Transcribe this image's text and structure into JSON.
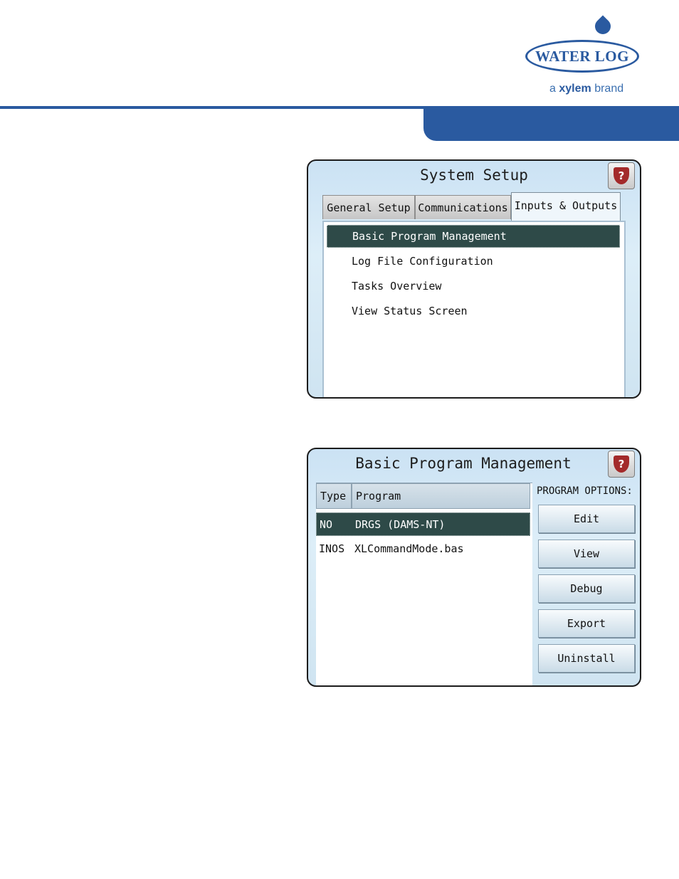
{
  "brand": {
    "logo_text": "WATER LOG",
    "tagline_prefix": "a",
    "tagline_brand": "xylem",
    "tagline_suffix": "brand"
  },
  "system_setup": {
    "title": "System Setup",
    "help_icon": "help-shield-icon",
    "help_glyph": "?",
    "tabs": [
      {
        "label": "General Setup",
        "active": false
      },
      {
        "label": "Communications",
        "active": false
      },
      {
        "label": "Inputs & Outputs",
        "active": true
      }
    ],
    "menu_items": [
      {
        "label": "Basic Program Management",
        "selected": true
      },
      {
        "label": "Log File Configuration",
        "selected": false
      },
      {
        "label": "Tasks Overview",
        "selected": false
      },
      {
        "label": "View Status Screen",
        "selected": false
      }
    ]
  },
  "program_management": {
    "title": "Basic Program Management",
    "help_glyph": "?",
    "columns": {
      "type": "Type",
      "program": "Program"
    },
    "rows": [
      {
        "type": "NO",
        "program": "DRGS (DAMS-NT)",
        "selected": true
      },
      {
        "type": "INOS",
        "program": "XLCommandMode.bas",
        "selected": false
      }
    ],
    "options_label": "PROGRAM OPTIONS:",
    "buttons": [
      "Edit",
      "View",
      "Debug",
      "Export",
      "Uninstall"
    ]
  },
  "colors": {
    "brand_blue": "#2a5aa0",
    "selection": "#2e4a48",
    "screen_bg": "#d4e8f5"
  }
}
